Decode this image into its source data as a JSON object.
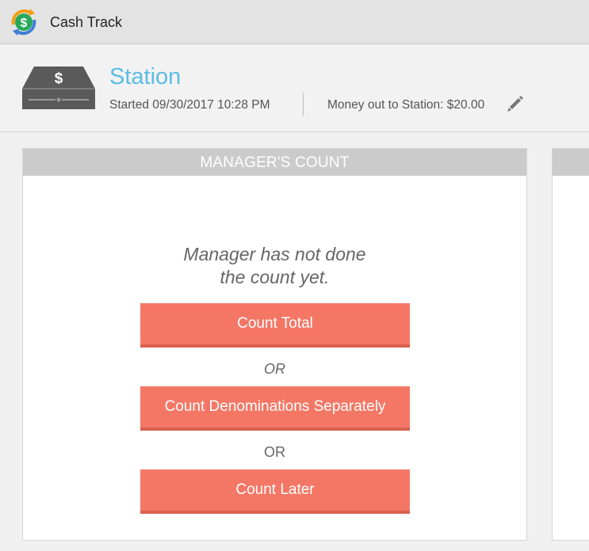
{
  "app": {
    "title": "Cash Track",
    "logo_icon": "cash-track-dollar-logo"
  },
  "station": {
    "name": "Station",
    "started": "Started 09/30/2017 10:28 PM",
    "money_out": "Money out to Station: $20.00",
    "register_icon": "cash-register-icon",
    "edit_icon": "pencil-icon"
  },
  "managers_count": {
    "header": "MANAGER'S COUNT",
    "message_line1": "Manager has not done",
    "message_line2": "the count yet.",
    "count_total_label": "Count Total",
    "or_label_1": "OR",
    "count_denominations_label": "Count Denominations Separately",
    "or_label_2": "OR",
    "count_later_label": "Count Later"
  },
  "colors": {
    "accent_button": "#f47766",
    "station_title": "#5bbce4",
    "card_header": "#cbcbcb"
  }
}
